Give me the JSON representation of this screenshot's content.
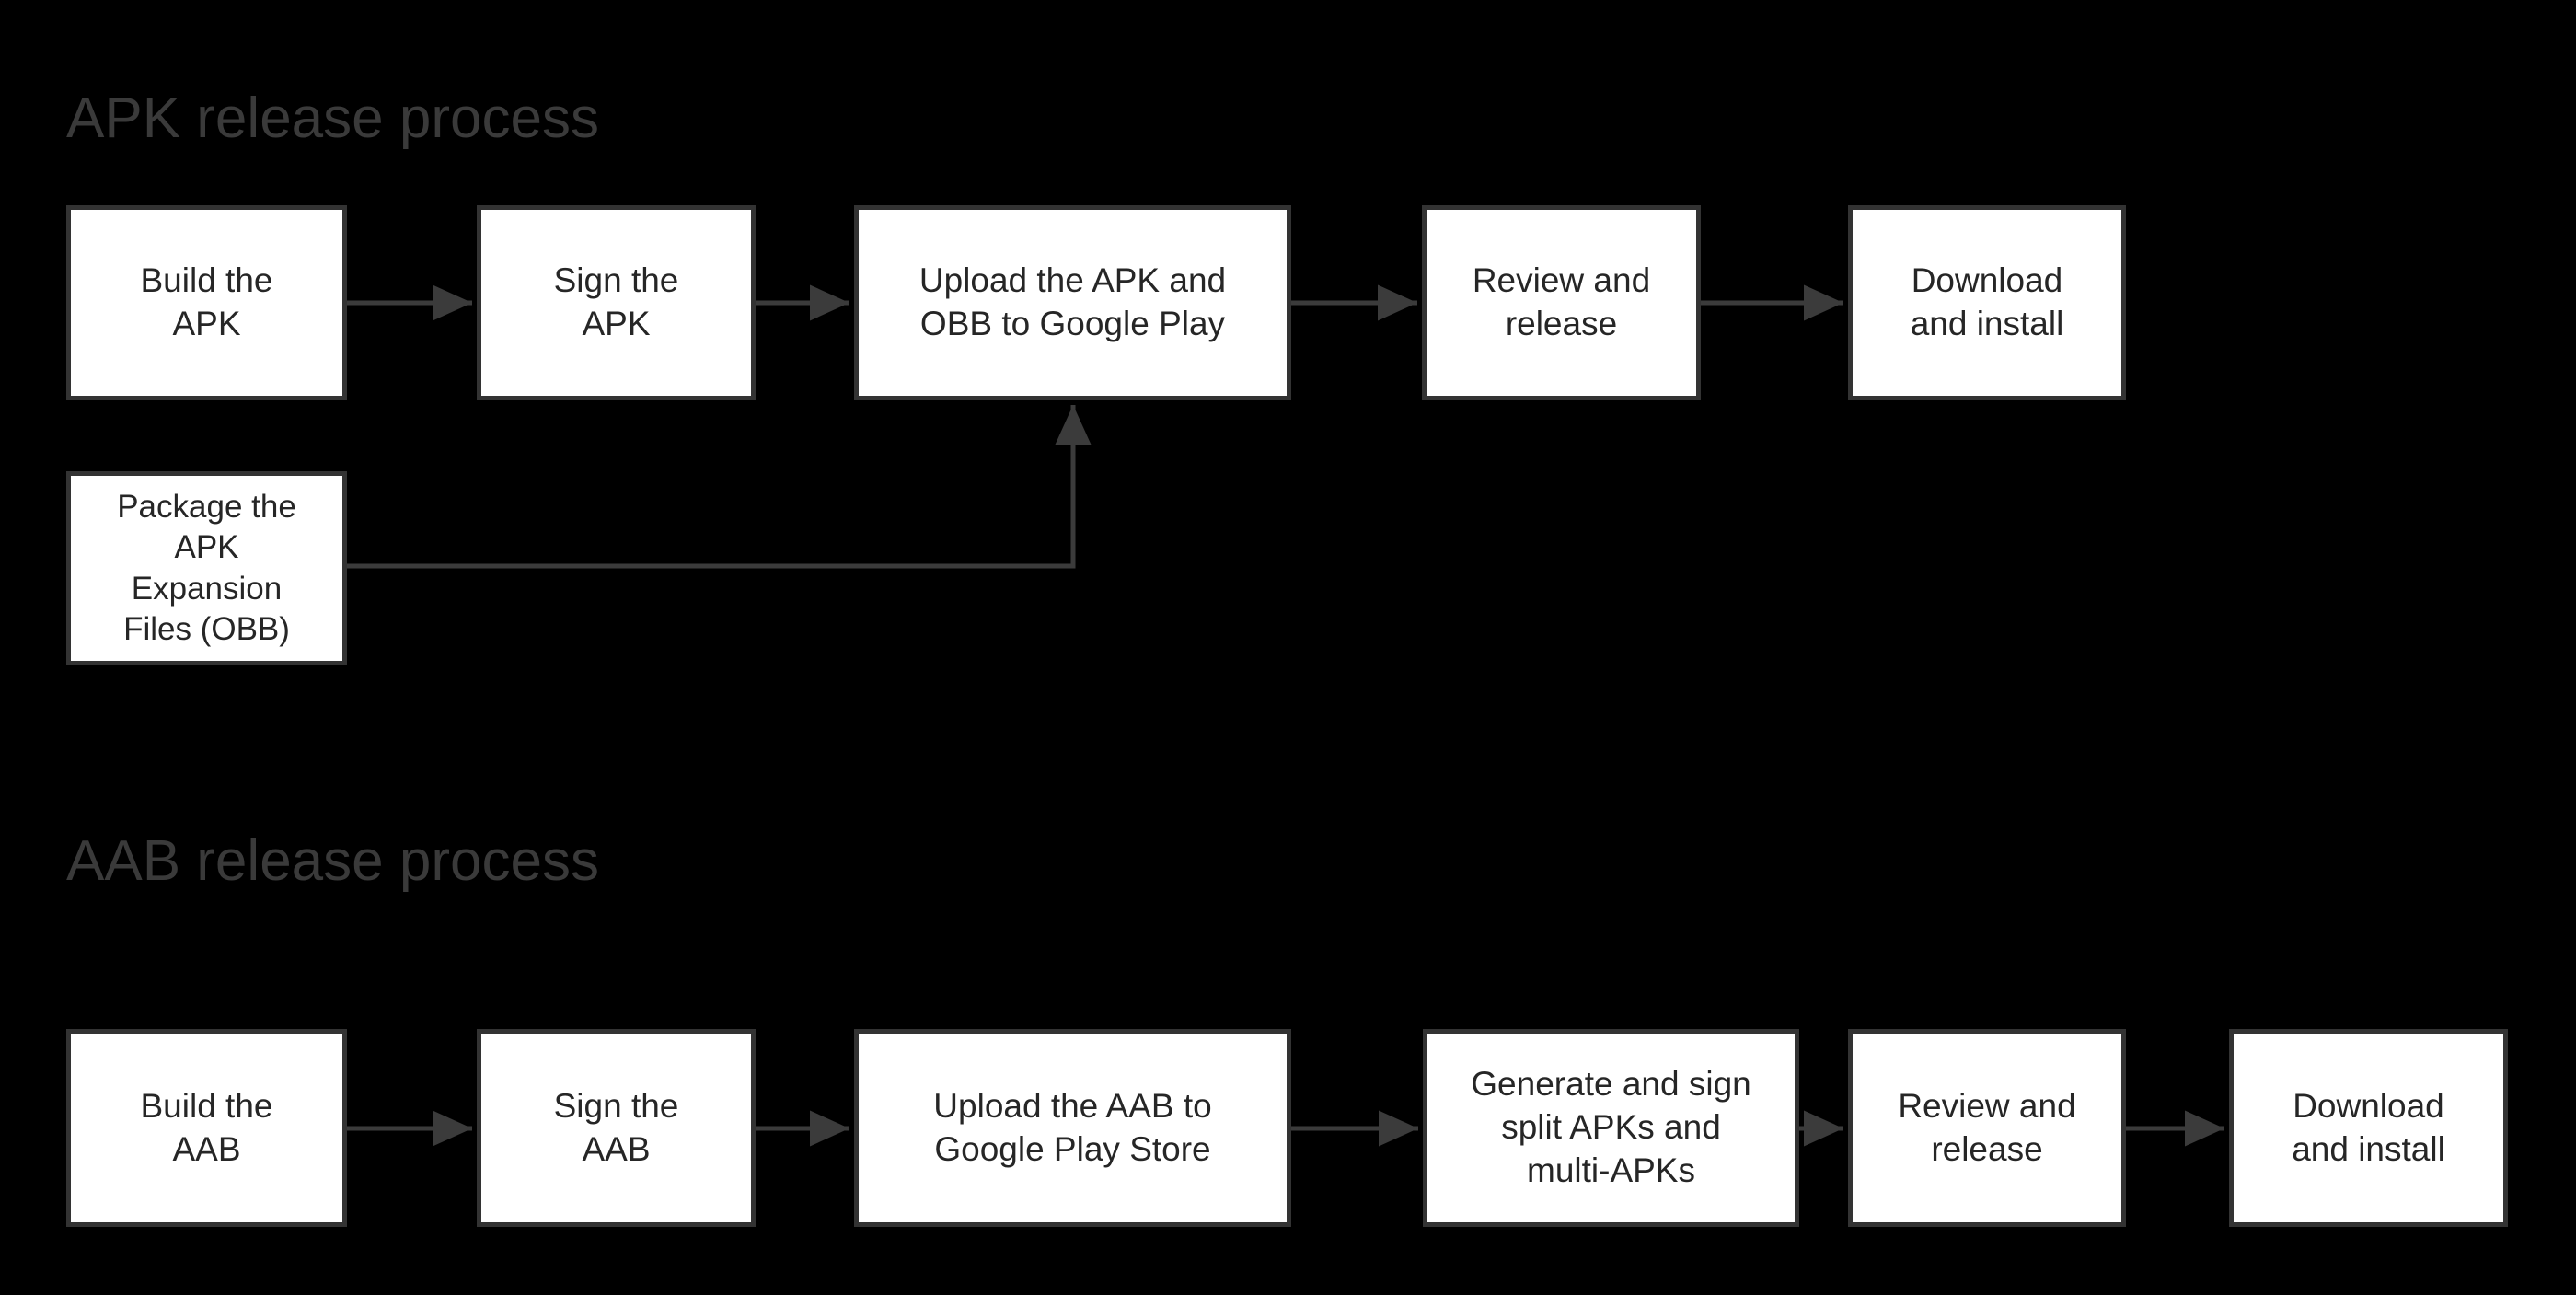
{
  "diagram": {
    "background_color": "#000000",
    "box_fill": "#ffffff",
    "box_border_color": "#333333",
    "box_text_color": "#262626",
    "title_color": "#3a3a3a",
    "arrow_color": "#3b3b3b",
    "sections": [
      {
        "id": "apk",
        "title": "APK release process",
        "nodes": [
          {
            "id": "apk-build",
            "label": "Build the\nAPK"
          },
          {
            "id": "apk-sign",
            "label": "Sign the\nAPK"
          },
          {
            "id": "apk-upload",
            "label": "Upload the APK and\nOBB to Google Play"
          },
          {
            "id": "apk-review",
            "label": "Review and\nrelease"
          },
          {
            "id": "apk-download",
            "label": "Download\nand install"
          },
          {
            "id": "apk-package-obb",
            "label": "Package the\nAPK\nExpansion\nFiles (OBB)"
          }
        ],
        "edges": [
          {
            "from": "apk-build",
            "to": "apk-sign",
            "type": "straight"
          },
          {
            "from": "apk-sign",
            "to": "apk-upload",
            "type": "straight"
          },
          {
            "from": "apk-upload",
            "to": "apk-review",
            "type": "straight"
          },
          {
            "from": "apk-review",
            "to": "apk-download",
            "type": "straight"
          },
          {
            "from": "apk-package-obb",
            "to": "apk-upload",
            "type": "elbow"
          }
        ]
      },
      {
        "id": "aab",
        "title": "AAB release process",
        "nodes": [
          {
            "id": "aab-build",
            "label": "Build the\nAAB"
          },
          {
            "id": "aab-sign",
            "label": "Sign the\nAAB"
          },
          {
            "id": "aab-upload",
            "label": "Upload the AAB to\nGoogle Play Store"
          },
          {
            "id": "aab-generate",
            "label": "Generate and sign\nsplit APKs and\nmulti-APKs"
          },
          {
            "id": "aab-review",
            "label": "Review and\nrelease"
          },
          {
            "id": "aab-download",
            "label": "Download\nand install"
          }
        ],
        "edges": [
          {
            "from": "aab-build",
            "to": "aab-sign",
            "type": "straight"
          },
          {
            "from": "aab-sign",
            "to": "aab-upload",
            "type": "straight"
          },
          {
            "from": "aab-upload",
            "to": "aab-generate",
            "type": "straight"
          },
          {
            "from": "aab-generate",
            "to": "aab-review",
            "type": "straight"
          },
          {
            "from": "aab-review",
            "to": "aab-download",
            "type": "straight"
          }
        ]
      }
    ]
  }
}
